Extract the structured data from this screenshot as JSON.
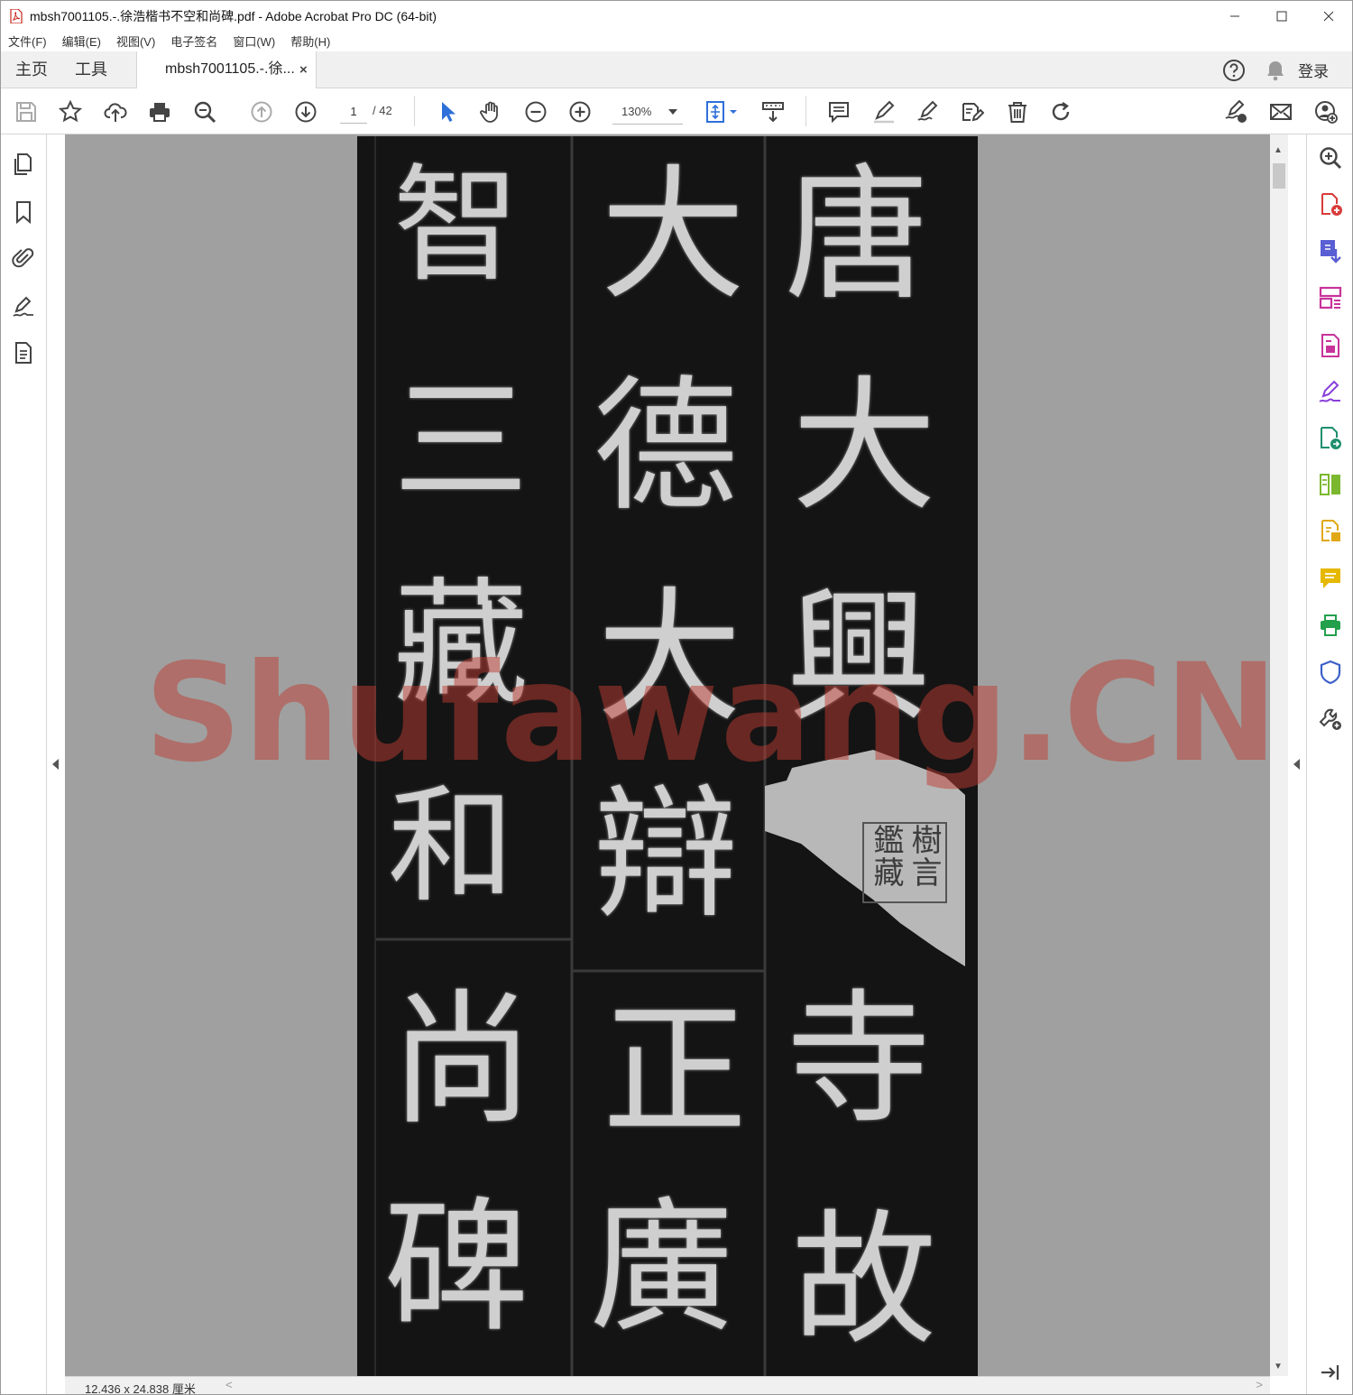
{
  "window": {
    "title": "mbsh7001105.-.徐浩楷书不空和尚碑.pdf - Adobe Acrobat Pro DC (64-bit)",
    "minimize_icon": "minimize-icon",
    "maximize_icon": "maximize-icon",
    "close_icon": "close-icon"
  },
  "menu": [
    "文件(F)",
    "编辑(E)",
    "视图(V)",
    "电子签名",
    "窗口(W)",
    "帮助(H)"
  ],
  "tabs": {
    "home": "主页",
    "tools": "工具",
    "document": "mbsh7001105.-.徐...",
    "close_glyph": "×",
    "login": "登录"
  },
  "toolbar": {
    "current_page": "1",
    "total_pages": "/ 42",
    "zoom": "130%"
  },
  "document": {
    "columns": [
      [
        "唐",
        "大",
        "興",
        "寺",
        "故"
      ],
      [
        "大",
        "德",
        "大",
        "辯",
        "正",
        "廣"
      ],
      [
        "智",
        "三",
        "藏",
        "和",
        "尚",
        "碑"
      ]
    ],
    "seal_text": "樹言鑑藏",
    "watermark": "Shufawang.CN"
  },
  "status": {
    "page_size": "12.436 x 24.838 厘米"
  },
  "colors": {
    "accent_blue": "#2e6fd9",
    "icon_gray": "#4a4a4a",
    "watermark_red": "#be3c32"
  }
}
